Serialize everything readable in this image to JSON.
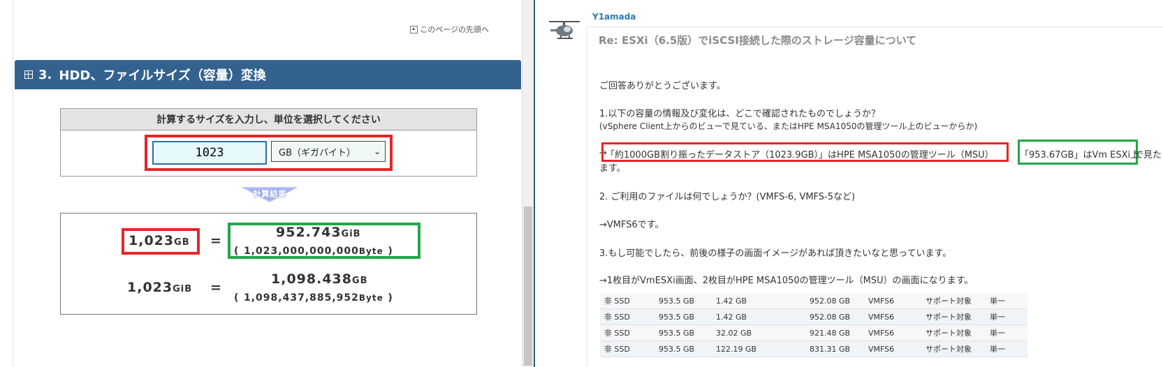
{
  "left": {
    "page_top_link": "このページの先頭へ",
    "section": {
      "number": "3.",
      "title": "HDD、ファイルサイズ（容量）変換"
    },
    "input_caption": "計算するサイズを入力し、単位を選択してください",
    "input_value": "1023",
    "unit_selected": "GB（ギガバイト）",
    "result_badge": "計算結果",
    "results": [
      {
        "input_num": "1,023",
        "input_unit": "GB",
        "eq": "=",
        "out_num": "952.743",
        "out_unit": "GiB",
        "open": "(",
        "bytes": "1,023,000,000,000",
        "byte_unit": "Byte",
        "close": ")"
      },
      {
        "input_num": "1,023",
        "input_unit": "GiB",
        "eq": "=",
        "out_num": "1,098.438",
        "out_unit": "GB",
        "open": "(",
        "bytes": "1,098,437,885,952",
        "byte_unit": "Byte",
        "close": ")"
      }
    ]
  },
  "right": {
    "username": "Y1amada",
    "title": "Re: ESXi（6.5版）でiSCSI接続した際のストレージ容量について",
    "greeting": "ご回答ありがとうございます。",
    "q1": "1.以下の容量の情報及び変化は、どこで確認されたものでしょうか？",
    "q1_sub": "(vSphere Client上からのビューで見ている、またはHPE MSA1050の管理ツール上のビューからか)",
    "a1_arrow": "→",
    "a1_red": "「約1000GB割り振ったデータストア（1023.9GB）」はHPE MSA1050の管理ツール（MSU）",
    "a1_green": "「953.67GB」はVm ESXi上",
    "a1_tail": "で見た",
    "a1_wrap": "ます。",
    "q2": "2. ご利用のファイルは何でしょうか？(VMFS-6, VMFS-5など)",
    "a2": "→VMFS6です。",
    "q3": "3.もし可能でしたら、前後の様子の画面イメージがあれば頂きたいなと思っています。",
    "a3": "→1枚目がVmESXi画面、2枚目がHPE MSA1050の管理ツール（MSU）の画面になります。",
    "table": [
      [
        "非 SSD",
        "953.5 GB",
        "1.42 GB",
        "952.08 GB",
        "VMFS6",
        "サポート対象",
        "単一"
      ],
      [
        "非 SSD",
        "953.5 GB",
        "1.42 GB",
        "952.08 GB",
        "VMFS6",
        "サポート対象",
        "単一"
      ],
      [
        "非 SSD",
        "953.5 GB",
        "32.02 GB",
        "921.48 GB",
        "VMFS6",
        "サポート対象",
        "単一"
      ],
      [
        "非 SSD",
        "953.5 GB",
        "122.19 GB",
        "831.31 GB",
        "VMFS6",
        "サポート対象",
        "単一"
      ]
    ]
  },
  "colors": {
    "header": "#34628f",
    "red_highlight": "#e5262a",
    "green_highlight": "#23a648",
    "input_border": "#2d6da3",
    "link": "#2a7ab0"
  },
  "icons": [
    "arrow-up-box-icon",
    "grid-icon",
    "dropdown-chevron-icon",
    "helicopter-avatar-icon"
  ]
}
